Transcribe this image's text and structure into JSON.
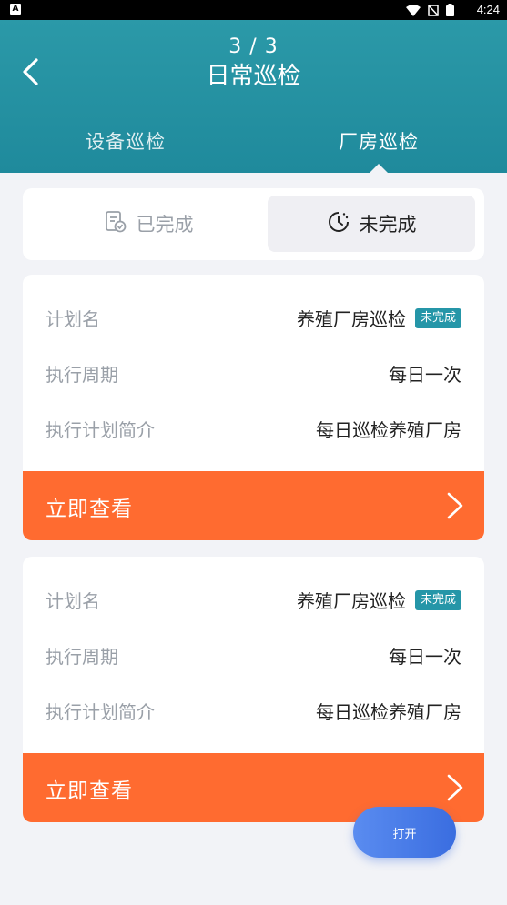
{
  "status_bar": {
    "time": "4:24",
    "left_badge": "A"
  },
  "header": {
    "page_indicator": "3 / 3",
    "title": "日常巡检",
    "tabs": [
      {
        "label": "设备巡检",
        "active": false
      },
      {
        "label": "厂房巡检",
        "active": true
      }
    ]
  },
  "filter": {
    "done_label": "已完成",
    "undone_label": "未完成",
    "selected": "未完成"
  },
  "cards": [
    {
      "rows": [
        {
          "label": "计划名",
          "value": "养殖厂房巡检",
          "badge": "未完成"
        },
        {
          "label": "执行周期",
          "value": "每日一次"
        },
        {
          "label": "执行计划简介",
          "value": "每日巡检养殖厂房"
        }
      ],
      "action_label": "立即查看"
    },
    {
      "rows": [
        {
          "label": "计划名",
          "value": "养殖厂房巡检",
          "badge": "未完成"
        },
        {
          "label": "执行周期",
          "value": "每日一次"
        },
        {
          "label": "执行计划简介",
          "value": "每日巡检养殖厂房"
        }
      ],
      "action_label": "立即查看"
    }
  ],
  "fab": {
    "label": "打开"
  },
  "colors": {
    "header": "#2b99a8",
    "badge": "#2596a8",
    "action": "#ff6b30",
    "fab": "#4a7de8"
  }
}
